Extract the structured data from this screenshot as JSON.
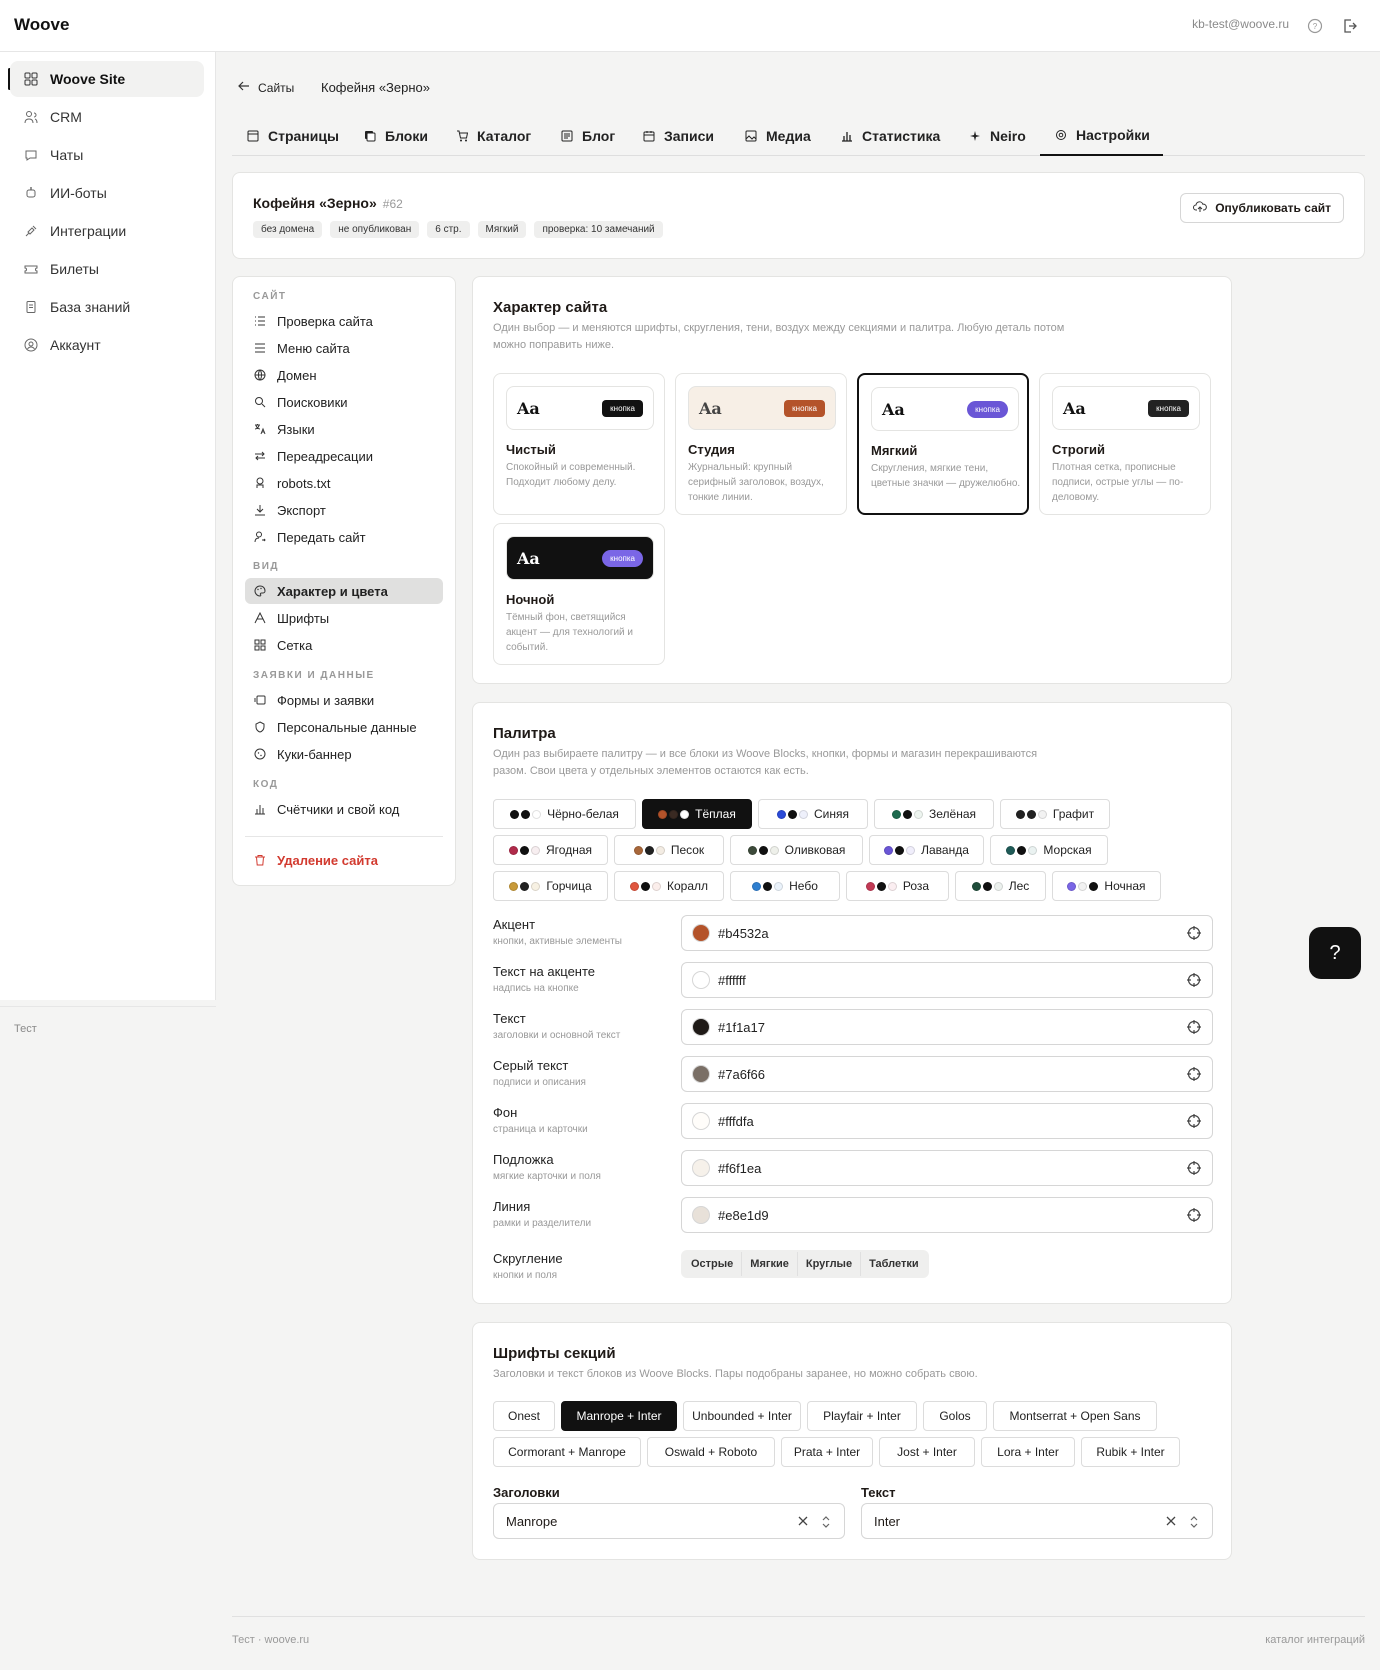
{
  "app": {
    "logo": "Woove",
    "user_email": "kb-test@woove.ru"
  },
  "sidebar": {
    "items": [
      {
        "label": "Woove Site",
        "icon": "grid-icon"
      },
      {
        "label": "CRM",
        "icon": "users-icon"
      },
      {
        "label": "Чаты",
        "icon": "chat-icon"
      },
      {
        "label": "ИИ-боты",
        "icon": "bot-icon"
      },
      {
        "label": "Интеграции",
        "icon": "plug-icon"
      },
      {
        "label": "Билеты",
        "icon": "ticket-icon"
      },
      {
        "label": "База знаний",
        "icon": "book-icon"
      },
      {
        "label": "Аккаунт",
        "icon": "account-icon"
      }
    ],
    "footer": "Тест"
  },
  "breadcrumb": {
    "back": "Сайты",
    "title": "Кофейня «Зерно»"
  },
  "tabs": [
    {
      "label": "Страницы"
    },
    {
      "label": "Блоки"
    },
    {
      "label": "Каталог"
    },
    {
      "label": "Блог"
    },
    {
      "label": "Записи"
    },
    {
      "label": "Медиа"
    },
    {
      "label": "Статистика"
    },
    {
      "label": "Neiro"
    },
    {
      "label": "Настройки"
    }
  ],
  "site": {
    "name": "Кофейня «Зерно»",
    "id": "#62",
    "badges": [
      "без домена",
      "не опубликован",
      "6 стр.",
      "Мягкий",
      "проверка: 10 замечаний"
    ],
    "publish": "Опубликовать сайт"
  },
  "settings_nav": {
    "sections": [
      "САЙТ",
      "ВИД",
      "ЗАЯВКИ И ДАННЫЕ",
      "КОД"
    ],
    "site": [
      "Проверка сайта",
      "Меню сайта",
      "Домен",
      "Поисковики",
      "Языки",
      "Переадресации",
      "robots.txt",
      "Экспорт",
      "Передать сайт"
    ],
    "view": [
      "Характер и цвета",
      "Шрифты",
      "Сетка"
    ],
    "data": [
      "Формы и заявки",
      "Персональные данные",
      "Куки-баннер"
    ],
    "code": [
      "Счётчики и свой код"
    ],
    "delete": "Удаление сайта"
  },
  "character": {
    "title": "Характер сайта",
    "desc": "Один выбор — и меняются шрифты, скругления, тени, воздух между секциями и палитра. Любую деталь потом можно поправить ниже.",
    "preview_aa": "Aa",
    "preview_btn": "кнопка",
    "styles": [
      {
        "name": "Чистый",
        "desc": "Спокойный и современный. Подходит любому делу.",
        "btn_color": "#111111",
        "bg": "#ffffff",
        "aa_color": "#111111"
      },
      {
        "name": "Студия",
        "desc": "Журнальный: крупный серифный заголовок, воздух, тонкие линии.",
        "btn_color": "#b4532a",
        "bg": "#f7efe6",
        "aa_color": "#444444"
      },
      {
        "name": "Мягкий",
        "desc": "Скругления, мягкие тени, цветные значки — дружелюбно.",
        "btn_color": "#6a56d6",
        "bg": "#ffffff",
        "aa_color": "#111111"
      },
      {
        "name": "Строгий",
        "desc": "Плотная сетка, прописные подписи, острые углы — по-деловому.",
        "btn_color": "#222222",
        "bg": "#ffffff",
        "aa_color": "#111111"
      },
      {
        "name": "Ночной",
        "desc": "Тёмный фон, светящийся акцент — для технологий и событий.",
        "btn_color": "#7a66e6",
        "bg": "#111111",
        "aa_color": "#ffffff"
      }
    ]
  },
  "palette": {
    "title": "Палитра",
    "desc": "Один раз выбираете палитру — и все блоки из Woove Blocks, кнопки, формы и магазин перекрашиваются разом. Свои цвета у отдельных элементов остаются как есть.",
    "presets": [
      {
        "name": "Чёрно-белая",
        "dots": [
          "#111111",
          "#111111",
          "#ffffff"
        ]
      },
      {
        "name": "Тёплая",
        "dots": [
          "#b4532a",
          "#3a2a22",
          "#ffffff"
        ]
      },
      {
        "name": "Синяя",
        "dots": [
          "#2b4bd8",
          "#111111",
          "#eef0fb"
        ]
      },
      {
        "name": "Зелёная",
        "dots": [
          "#1f6b4f",
          "#111111",
          "#eef5f0"
        ]
      },
      {
        "name": "Графит",
        "dots": [
          "#222222",
          "#222222",
          "#f2f2f2"
        ]
      },
      {
        "name": "Ягодная",
        "dots": [
          "#b02a4a",
          "#111111",
          "#f7eef0"
        ]
      },
      {
        "name": "Песок",
        "dots": [
          "#a8673a",
          "#222222",
          "#f3ece3"
        ]
      },
      {
        "name": "Оливковая",
        "dots": [
          "#3d4a3a",
          "#111111",
          "#eef0ea"
        ]
      },
      {
        "name": "Лаванда",
        "dots": [
          "#6a56d6",
          "#111111",
          "#f0eefb"
        ]
      },
      {
        "name": "Морская",
        "dots": [
          "#1f5b57",
          "#111111",
          "#eaf2f1"
        ]
      },
      {
        "name": "Горчица",
        "dots": [
          "#c89a3a",
          "#222222",
          "#f7f1e3"
        ]
      },
      {
        "name": "Коралл",
        "dots": [
          "#e0563f",
          "#111111",
          "#fbeeeb"
        ]
      },
      {
        "name": "Небо",
        "dots": [
          "#2f7fd0",
          "#111111",
          "#ebf3fb"
        ]
      },
      {
        "name": "Роза",
        "dots": [
          "#c23a55",
          "#111111",
          "#fbeef1"
        ]
      },
      {
        "name": "Лес",
        "dots": [
          "#1f4d3a",
          "#111111",
          "#ecf1ee"
        ]
      },
      {
        "name": "Ночная",
        "dots": [
          "#7a66e6",
          "#f2f2f2",
          "#111111"
        ]
      }
    ],
    "colors": [
      {
        "label": "Акцент",
        "sub": "кнопки, активные элементы",
        "value": "#b4532a"
      },
      {
        "label": "Текст на акценте",
        "sub": "надпись на кнопке",
        "value": "#ffffff"
      },
      {
        "label": "Текст",
        "sub": "заголовки и основной текст",
        "value": "#1f1a17"
      },
      {
        "label": "Серый текст",
        "sub": "подписи и описания",
        "value": "#7a6f66"
      },
      {
        "label": "Фон",
        "sub": "страница и карточки",
        "value": "#fffdfa"
      },
      {
        "label": "Подложка",
        "sub": "мягкие карточки и поля",
        "value": "#f6f1ea"
      },
      {
        "label": "Линия",
        "sub": "рамки и разделители",
        "value": "#e8e1d9"
      }
    ],
    "radius": {
      "label": "Скругление",
      "sub": "кнопки и поля",
      "options": [
        "Острые",
        "Мягкие",
        "Круглые",
        "Таблетки"
      ]
    }
  },
  "fonts": {
    "title": "Шрифты секций",
    "desc": "Заголовки и текст блоков из Woove Blocks. Пары подобраны заранее, но можно собрать свою.",
    "pairs": [
      "Onest",
      "Manrope + Inter",
      "Unbounded + Inter",
      "Playfair + Inter",
      "Golos",
      "Montserrat + Open Sans",
      "Cormorant + Manrope",
      "Oswald + Roboto",
      "Prata + Inter",
      "Jost + Inter",
      "Lora + Inter",
      "Rubik + Inter"
    ],
    "headings_label": "Заголовки",
    "headings_value": "Manrope",
    "text_label": "Текст",
    "text_value": "Inter"
  },
  "help": "?",
  "footer": {
    "left": "Тест · woove.ru",
    "right": "каталог интеграций"
  }
}
